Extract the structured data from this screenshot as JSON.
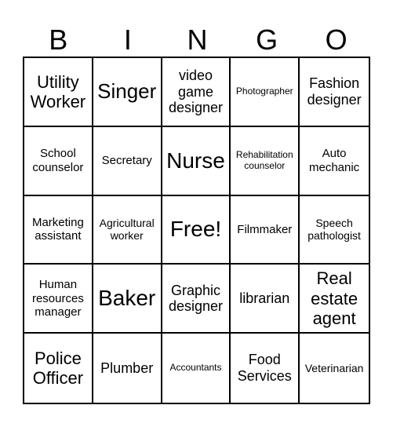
{
  "header": {
    "letters": [
      "B",
      "I",
      "N",
      "G",
      "O"
    ]
  },
  "cells": [
    [
      {
        "text": "Utility Worker",
        "size": "l"
      },
      {
        "text": "Singer",
        "size": "xl"
      },
      {
        "text": "video game designer",
        "size": "m"
      },
      {
        "text": "Photographer",
        "size": "xs"
      },
      {
        "text": "Fashion designer",
        "size": "m"
      }
    ],
    [
      {
        "text": "School counselor",
        "size": "s"
      },
      {
        "text": "Secretary",
        "size": "s"
      },
      {
        "text": "Nurse",
        "size": "xxl"
      },
      {
        "text": "Rehabilitation counselor",
        "size": "xs"
      },
      {
        "text": "Auto mechanic",
        "size": "s"
      }
    ],
    [
      {
        "text": "Marketing assistant",
        "size": "s"
      },
      {
        "text": "Agricultural worker",
        "size": "xs2"
      },
      {
        "text": "Free!",
        "size": "xxl"
      },
      {
        "text": "Filmmaker",
        "size": "s"
      },
      {
        "text": "Speech pathologist",
        "size": "xs2"
      }
    ],
    [
      {
        "text": "Human resources manager",
        "size": "s"
      },
      {
        "text": "Baker",
        "size": "xxl"
      },
      {
        "text": "Graphic designer",
        "size": "m"
      },
      {
        "text": "librarian",
        "size": "m"
      },
      {
        "text": "Real estate agent",
        "size": "l"
      }
    ],
    [
      {
        "text": "Police Officer",
        "size": "l"
      },
      {
        "text": "Plumber",
        "size": "m"
      },
      {
        "text": "Accountants",
        "size": "xs"
      },
      {
        "text": "Food Services",
        "size": "m"
      },
      {
        "text": "Veterinarian",
        "size": "xs2"
      }
    ]
  ]
}
